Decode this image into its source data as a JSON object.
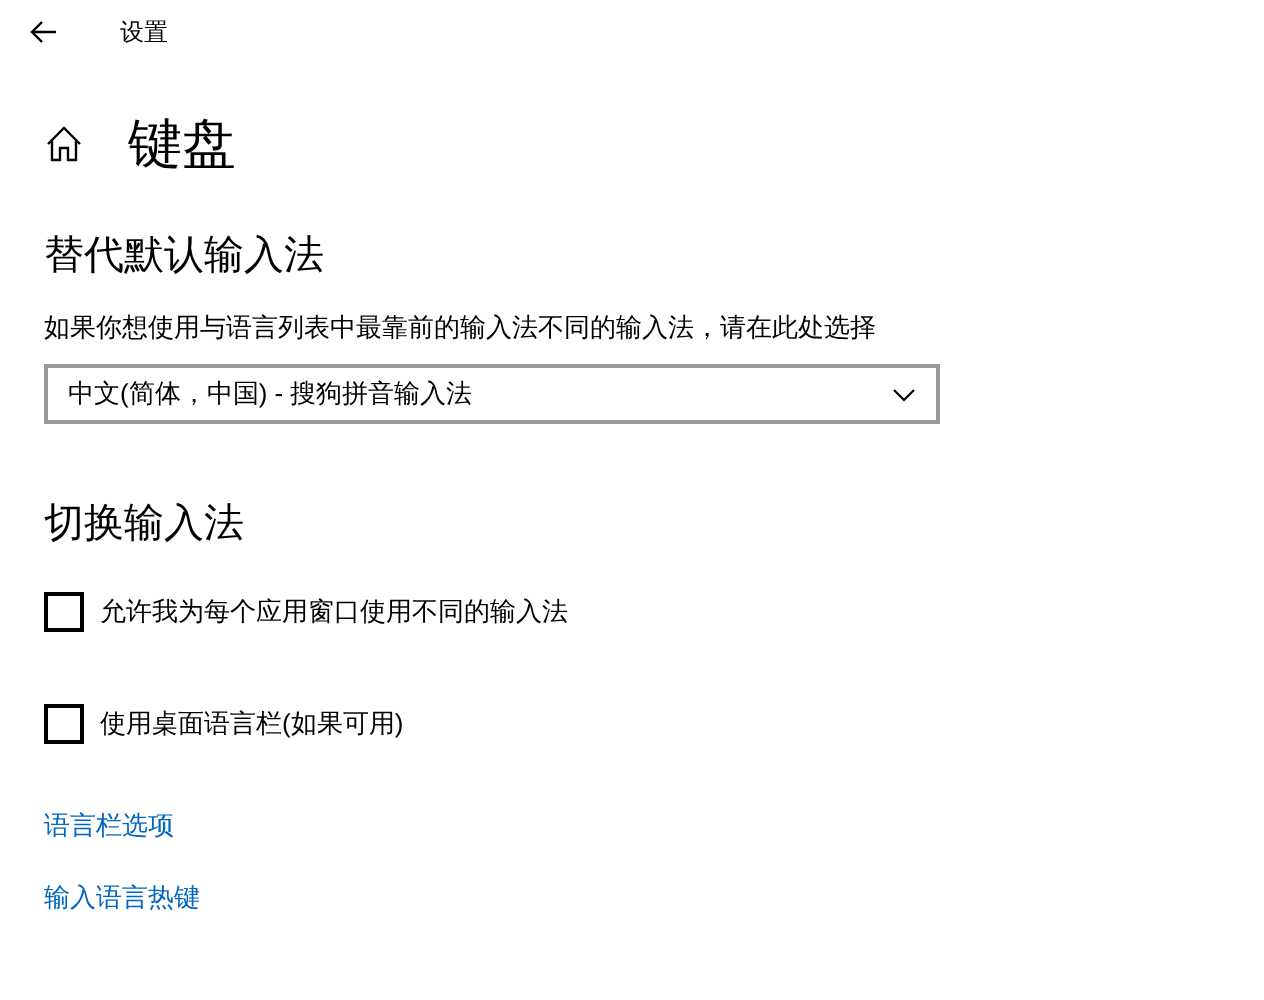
{
  "window": {
    "title": "设置"
  },
  "page": {
    "title": "键盘"
  },
  "sections": [
    {
      "heading": "替代默认输入法",
      "description": "如果你想使用与语言列表中最靠前的输入法不同的输入法，请在此处选择",
      "dropdown": {
        "value": "中文(简体，中国) - 搜狗拼音输入法"
      }
    },
    {
      "heading": "切换输入法",
      "checkboxes": [
        {
          "label": "允许我为每个应用窗口使用不同的输入法",
          "checked": false
        },
        {
          "label": "使用桌面语言栏(如果可用)",
          "checked": false
        }
      ]
    }
  ],
  "links": [
    "语言栏选项",
    "输入语言热键"
  ]
}
